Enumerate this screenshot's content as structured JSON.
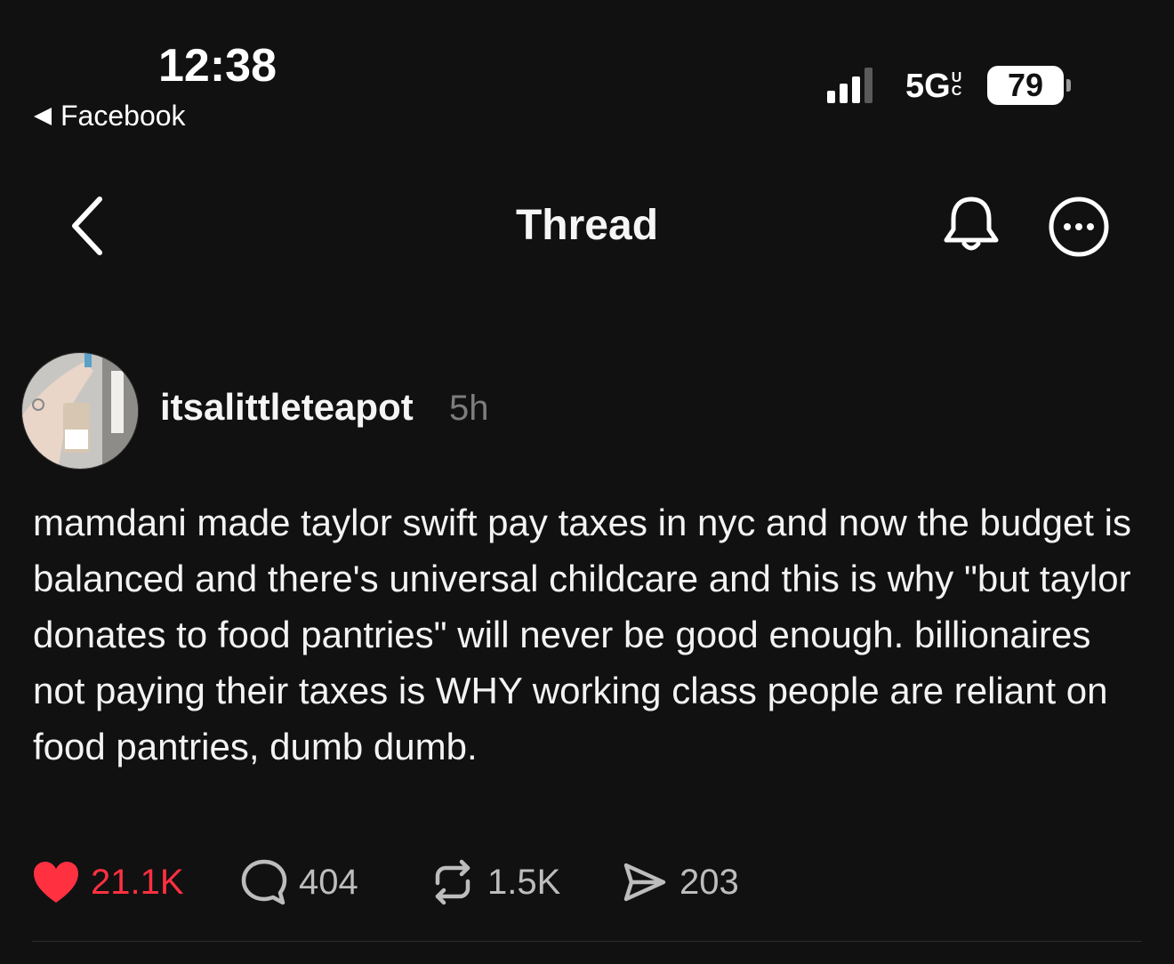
{
  "status_bar": {
    "time": "12:38",
    "back_app": "Facebook",
    "network": "5G",
    "network_sup_top": "U",
    "network_sup_bottom": "C",
    "battery": "79"
  },
  "nav": {
    "title": "Thread"
  },
  "post": {
    "username": "itsalittleteapot",
    "time_ago": "5h",
    "text": "mamdani made taylor swift pay taxes in nyc and now the budget is balanced and there's universal childcare and this is why \"but taylor donates to food pantries\" will never be good enough. billionaires not paying their taxes is WHY working class people are reliant on food pantries, dumb dumb.",
    "likes": "21.1K",
    "comments": "404",
    "reposts": "1.5K",
    "shares": "203",
    "liked": true
  },
  "colors": {
    "background": "#111111",
    "like_red": "#ff3040",
    "muted_text": "#7d7d7d"
  },
  "icons": [
    "back-triangle-icon",
    "signal-icon",
    "chevron-left-icon",
    "bell-icon",
    "more-icon",
    "heart-icon",
    "comment-icon",
    "repost-icon",
    "share-icon"
  ]
}
